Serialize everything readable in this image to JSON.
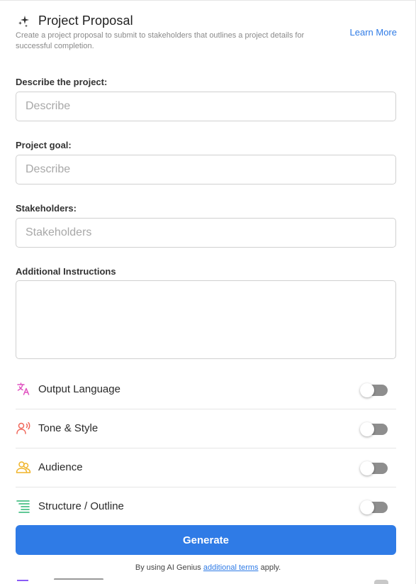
{
  "header": {
    "title": "Project Proposal",
    "subtitle": "Create a project proposal to submit to stakeholders that outlines a project details for successful completion.",
    "learn_more": "Learn More",
    "icon": "sparkles-icon"
  },
  "form": {
    "describe": {
      "label": "Describe the project:",
      "placeholder": "Describe",
      "value": ""
    },
    "goal": {
      "label": "Project goal:",
      "placeholder": "Describe",
      "value": ""
    },
    "stakeholders": {
      "label": "Stakeholders:",
      "placeholder": "Stakeholders",
      "value": ""
    },
    "instructions": {
      "label": "Additional Instructions",
      "value": ""
    }
  },
  "options": [
    {
      "label": "Output Language",
      "icon": "translate-icon",
      "color": "#e052c0",
      "enabled": false
    },
    {
      "label": "Tone & Style",
      "icon": "user-voice-icon",
      "color": "#f0675a",
      "enabled": false
    },
    {
      "label": "Audience",
      "icon": "users-icon",
      "color": "#f0b429",
      "enabled": false
    },
    {
      "label": "Structure / Outline",
      "icon": "outline-list-icon",
      "color": "#2bb673",
      "enabled": false
    }
  ],
  "footer": {
    "generate_label": "Generate",
    "terms_prefix": "By using AI Genius",
    "terms_link": "additional terms",
    "terms_suffix": "apply."
  },
  "colors": {
    "accent": "#2f7be6",
    "toggle_off": "#8e8e8e",
    "border": "#d0d0d0"
  }
}
